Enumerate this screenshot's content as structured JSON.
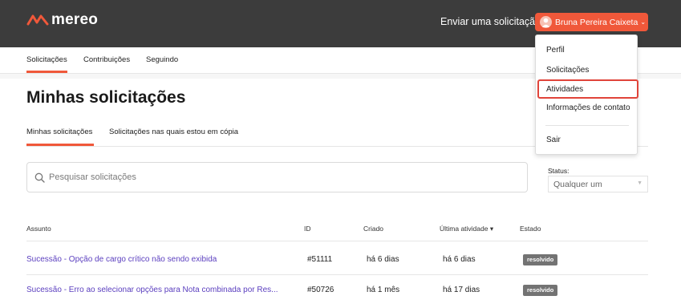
{
  "header": {
    "logo_text": "mereo",
    "submit_request": "Enviar uma solicitação",
    "user_name": "Bruna Pereira Caixeta",
    "user_caret": "⌄",
    "brand_color": "#f0583a"
  },
  "subnav": {
    "items": [
      "Solicitações",
      "Contribuições",
      "Seguindo"
    ]
  },
  "page": {
    "title": "Minhas solicitações",
    "tabs": [
      "Minhas solicitações",
      "Solicitações nas quais estou em cópia"
    ]
  },
  "search": {
    "placeholder": "Pesquisar solicitações"
  },
  "status_filter": {
    "label": "Status:",
    "value": "Qualquer um",
    "caret": "▼"
  },
  "table": {
    "headers": {
      "subject": "Assunto",
      "id": "ID",
      "created": "Criado",
      "last_activity": "Última atividade ▾",
      "state": "Estado"
    },
    "rows": [
      {
        "subject": "Sucessão - Opção de cargo crítico não sendo exibida",
        "id": "#51111",
        "created": "há 6 dias",
        "last_activity": "há 6 dias",
        "state": "resolvido"
      },
      {
        "subject": "Sucessão - Erro ao selecionar opções para Nota combinada por Res...",
        "id": "#50726",
        "created": "há 1 mês",
        "last_activity": "há 17 dias",
        "state": "resolvido"
      }
    ]
  },
  "user_menu": {
    "items": [
      "Perfil",
      "Solicitações",
      "Atividades",
      "Informações de contato",
      "Sair"
    ],
    "highlighted": "Atividades"
  }
}
